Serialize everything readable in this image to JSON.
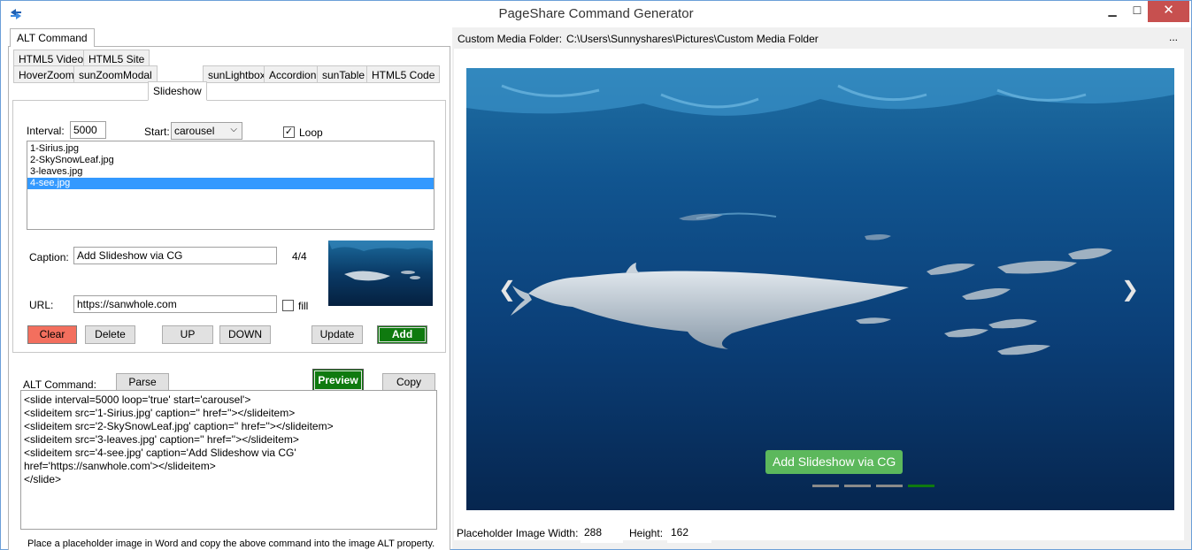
{
  "window": {
    "title": "PageShare Command Generator",
    "min": "▁",
    "max": "☐",
    "close": "✕"
  },
  "left": {
    "alt_tab": "ALT Command",
    "tabs_row1": [
      "HTML5 Video",
      "HTML5 Site"
    ],
    "tabs_row2": [
      "HoverZoom",
      "sunZoomModal",
      "Slideshow",
      "sunLightbox",
      "Accordion",
      "sunTable",
      "HTML5 Code"
    ],
    "interval_label": "Interval:",
    "interval_value": "5000",
    "start_label": "Start:",
    "start_value": "carousel",
    "loop_label": "Loop",
    "loop_checked": "✓",
    "files": [
      "1-Sirius.jpg",
      "2-SkySnowLeaf.jpg",
      "3-leaves.jpg",
      "4-see.jpg"
    ],
    "caption_label": "Caption:",
    "caption_value": "Add Slideshow via CG",
    "counter": "4/4",
    "url_label": "URL:",
    "url_value": "https://sanwhole.com",
    "fill_label": "fill",
    "buttons": {
      "clear": "Clear",
      "delete": "Delete",
      "up": "UP",
      "down": "DOWN",
      "update": "Update",
      "add": "Add"
    },
    "alt_command_label": "ALT Command:",
    "parse": "Parse",
    "preview": "Preview",
    "copy": "Copy",
    "command_lines": [
      "<slide interval=5000 loop='true' start='carousel'>",
      "<slideitem src='1-Sirius.jpg' caption='' href=''></slideitem>",
      "<slideitem src='2-SkySnowLeaf.jpg' caption='' href=''></slideitem>",
      "<slideitem src='3-leaves.jpg' caption='' href=''></slideitem>",
      "<slideitem src='4-see.jpg' caption='Add Slideshow via CG'",
      "href='https://sanwhole.com'></slideitem>",
      "</slide>"
    ],
    "hint": "Place a placeholder image in Word and copy the above command into the image ALT property."
  },
  "right": {
    "folder_label": "Custom Media Folder:",
    "folder_path": "C:\\Users\\Sunnyshares\\Pictures\\Custom Media Folder",
    "folder_more": "...",
    "slide_caption": "Add Slideshow via CG",
    "prev_arrow": "❮",
    "next_arrow": "❯",
    "placeholder_width_label": "Placeholder Image Width:",
    "placeholder_width": "288",
    "height_label": "Height:",
    "placeholder_height": "162"
  },
  "colors": {
    "accent_green": "#0f7a0f",
    "clear_red": "#f36f5e",
    "caption_green": "#5cb85c",
    "selection_blue": "#3399ff"
  }
}
